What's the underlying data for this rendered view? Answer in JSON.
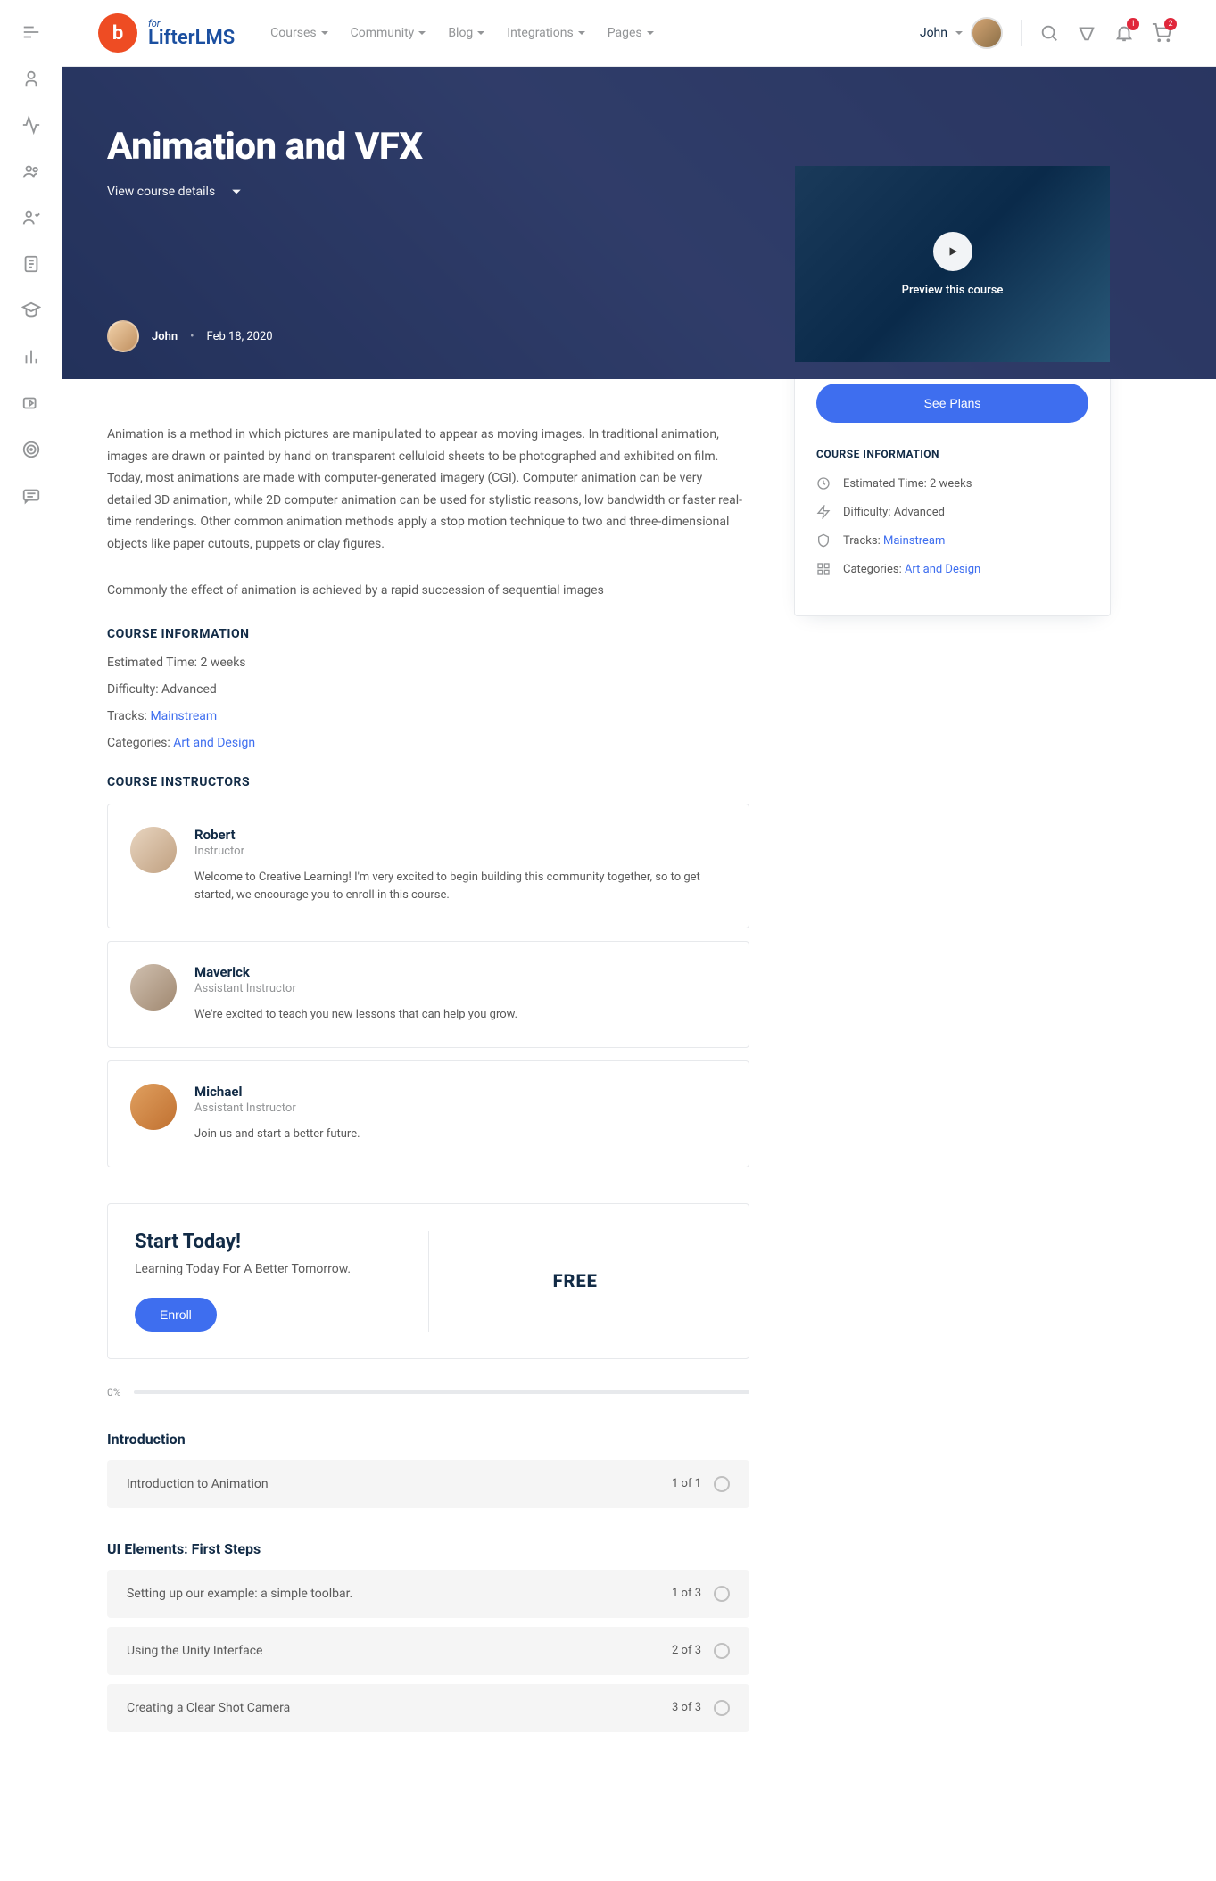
{
  "brand": {
    "for": "for",
    "name": "LifterLMS"
  },
  "nav": [
    "Courses",
    "Community",
    "Blog",
    "Integrations",
    "Pages"
  ],
  "user": {
    "name": "John"
  },
  "badges": {
    "bell": "1",
    "cart": "2"
  },
  "hero": {
    "title": "Animation and VFX",
    "details": "View course details",
    "author": "John",
    "date": "Feb 18, 2020"
  },
  "sidebar": {
    "preview": "Preview this course",
    "cta": "See Plans",
    "title": "COURSE INFORMATION",
    "info": [
      {
        "label": "Estimated Time:",
        "value": "2 weeks"
      },
      {
        "label": "Difficulty:",
        "value": "Advanced"
      },
      {
        "label": "Tracks:",
        "link": "Mainstream"
      },
      {
        "label": "Categories:",
        "link": "Art and Design"
      }
    ]
  },
  "desc1": "Animation is a method in which pictures are manipulated to appear as moving images. In traditional animation, images are drawn or painted by hand on transparent celluloid sheets to be photographed and exhibited on film. Today, most animations are made with computer-generated imagery (CGI). Computer animation can be very detailed 3D animation, while 2D computer animation can be used for stylistic reasons, low bandwidth or faster real-time renderings. Other common animation methods apply a stop motion technique to two and three-dimensional objects like paper cutouts, puppets or clay figures.",
  "desc2": "Commonly the effect of animation is achieved by a rapid succession of sequential images",
  "info_title": "COURSE INFORMATION",
  "info": [
    {
      "text": "Estimated Time: 2 weeks"
    },
    {
      "text": "Difficulty: Advanced"
    },
    {
      "label": "Tracks: ",
      "link": "Mainstream"
    },
    {
      "label": "Categories: ",
      "link": "Art and Design"
    }
  ],
  "inst_title": "COURSE INSTRUCTORS",
  "instructors": [
    {
      "name": "Robert",
      "role": "Instructor",
      "bio": "Welcome to Creative Learning! I'm very excited to begin building this community together, so to get started, we encourage you to enroll in this course.",
      "cls": "r"
    },
    {
      "name": "Maverick",
      "role": "Assistant Instructor",
      "bio": "We're excited to teach you new lessons that can help you grow.",
      "cls": "m"
    },
    {
      "name": "Michael",
      "role": "Assistant Instructor",
      "bio": "Join us and start a better future.",
      "cls": "mi"
    }
  ],
  "enroll": {
    "title": "Start Today!",
    "sub": "Learning Today For A Better Tomorrow.",
    "btn": "Enroll",
    "price": "FREE"
  },
  "progress": "0%",
  "sections": [
    {
      "title": "Introduction",
      "lessons": [
        {
          "name": "Introduction to Animation",
          "meta": "1 of 1"
        }
      ]
    },
    {
      "title": "UI Elements: First Steps",
      "lessons": [
        {
          "name": "Setting up our example: a simple toolbar.",
          "meta": "1 of 3"
        },
        {
          "name": "Using the Unity Interface",
          "meta": "2 of 3"
        },
        {
          "name": "Creating a Clear Shot Camera",
          "meta": "3 of 3"
        }
      ]
    }
  ]
}
